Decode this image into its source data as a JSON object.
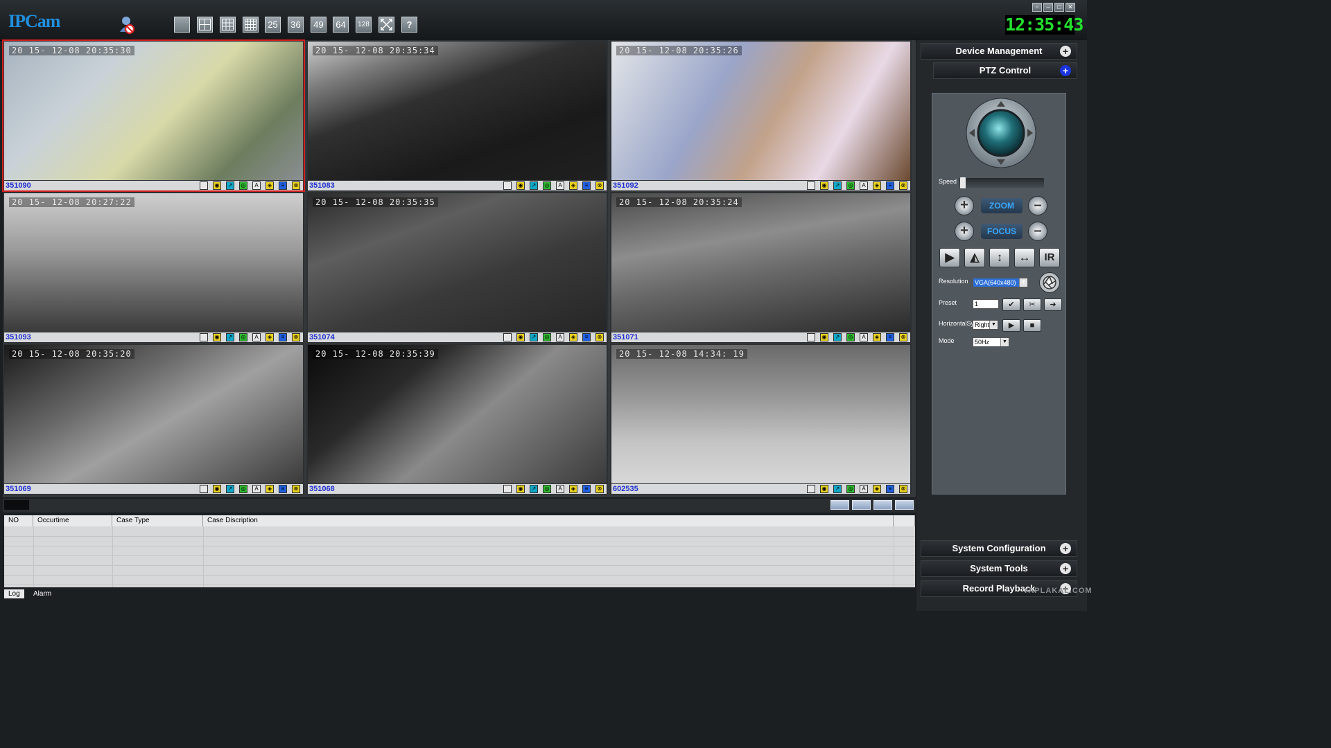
{
  "app": {
    "title": "IPCam",
    "clock": "12:35:43"
  },
  "toolbar": {
    "layouts": [
      "1",
      "4",
      "9",
      "16",
      "25",
      "36",
      "49",
      "64",
      "128"
    ],
    "fullscreen_icon": "fullscreen-icon",
    "help_label": "?"
  },
  "cameras": [
    {
      "id": "351090",
      "timestamp": "20 15- 12-08  20:35:30"
    },
    {
      "id": "351083",
      "timestamp": "20 15- 12-08  20:35:34"
    },
    {
      "id": "351092",
      "timestamp": "20 15- 12-08  20:35:26"
    },
    {
      "id": "351093",
      "timestamp": "20 15- 12-08  20:27:22"
    },
    {
      "id": "351074",
      "timestamp": "20 15- 12-08  20:35:35"
    },
    {
      "id": "351071",
      "timestamp": "20 15- 12-08  20:35:24"
    },
    {
      "id": "351069",
      "timestamp": "20 15- 12-08  20:35:20"
    },
    {
      "id": "351068",
      "timestamp": "20 15- 12-08  20:35:39"
    },
    {
      "id": "602535",
      "timestamp": "20 15- 12-08  14:34: 19"
    }
  ],
  "log": {
    "columns": [
      "NO",
      "Occurtime",
      "Case Type",
      "Case Discription"
    ],
    "tabs": [
      "Log",
      "Alarm"
    ]
  },
  "sidebar": {
    "device_management": "Device Management",
    "ptz_control": "PTZ Control",
    "system_configuration": "System Configuration",
    "system_tools": "System Tools",
    "record_playback": "Record Playback"
  },
  "ptz": {
    "speed_label": "Speed",
    "zoom_label": "ZOOM",
    "focus_label": "FOCUS",
    "ir_label": "IR",
    "resolution_label": "Resolution",
    "resolution_value": "VGA(640x480)",
    "preset_label": "Preset",
    "preset_value": "1",
    "horizontal_label": "HorizontalSy",
    "horizontal_value": "Right",
    "mode_label": "Mode",
    "mode_value": "50Hz"
  },
  "watermark": "YAPLAKAL.COM"
}
